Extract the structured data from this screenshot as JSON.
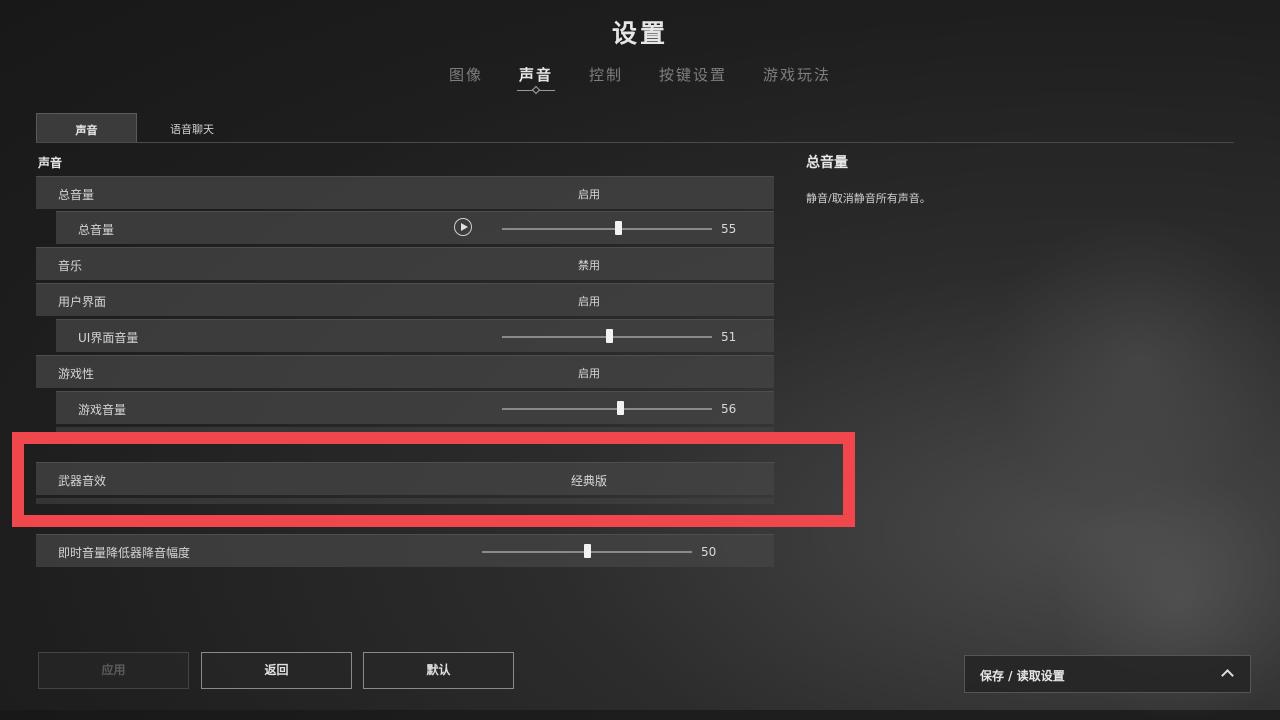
{
  "title": "设置",
  "top_tabs": [
    {
      "label": "图像"
    },
    {
      "label": "声音"
    },
    {
      "label": "控制"
    },
    {
      "label": "按键设置"
    },
    {
      "label": "游戏玩法"
    }
  ],
  "sub_tabs": [
    {
      "label": "声音"
    },
    {
      "label": "语音聊天"
    }
  ],
  "section_title": "声音",
  "rows": {
    "master": {
      "label": "总音量",
      "value": "启用"
    },
    "master_volume": {
      "label": "总音量",
      "value": "55",
      "level": 55
    },
    "music": {
      "label": "音乐",
      "value": "禁用"
    },
    "ui": {
      "label": "用户界面",
      "value": "启用"
    },
    "ui_volume": {
      "label": "UI界面音量",
      "value": "51",
      "level": 51
    },
    "gameplay": {
      "label": "游戏性",
      "value": "启用"
    },
    "game_volume": {
      "label": "游戏音量",
      "value": "56",
      "level": 56
    },
    "weapon_sfx": {
      "label": "武器音效",
      "value": "经典版"
    },
    "ducking": {
      "label": "即时音量降低器降音幅度",
      "value": "50",
      "level": 50
    }
  },
  "description": {
    "title": "总音量",
    "text": "静音/取消静音所有声音。"
  },
  "buttons": {
    "apply": "应用",
    "back": "返回",
    "default": "默认"
  },
  "save_bar": {
    "label": "保存 / 读取设置"
  },
  "colors": {
    "highlight": "#f0474c"
  }
}
